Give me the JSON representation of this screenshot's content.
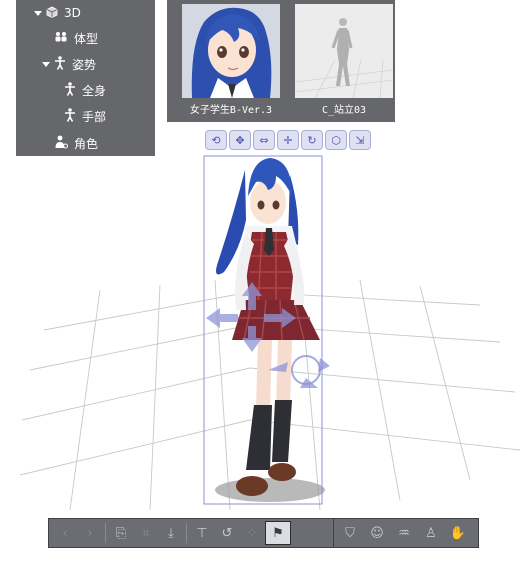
{
  "tree": {
    "items": [
      {
        "label": "3D",
        "icon": "cube-icon",
        "level": 0,
        "expanded": true
      },
      {
        "label": "体型",
        "icon": "body-shape-icon",
        "level": 1
      },
      {
        "label": "姿势",
        "icon": "pose-figure-icon",
        "level": 1,
        "expanded": true
      },
      {
        "label": "全身",
        "icon": "figure-icon",
        "level": 2
      },
      {
        "label": "手部",
        "icon": "figure-icon",
        "level": 2
      },
      {
        "label": "角色",
        "icon": "character-icon",
        "level": 1
      }
    ]
  },
  "preview": {
    "model_name": "女子学生B-Ver.3",
    "pose_name": "C_站立03"
  },
  "transform_toolbar": {
    "tools": [
      "rotate-camera-icon",
      "pan-camera-icon",
      "zoom-camera-icon",
      "move-object-icon",
      "rotate-object-icon",
      "rotate-3d-icon",
      "move-plane-icon"
    ]
  },
  "bottom_toolbar": {
    "left_tools": [
      {
        "icon": "prev-arrow-icon",
        "state": "disabled"
      },
      {
        "icon": "next-arrow-icon",
        "state": "disabled"
      },
      {
        "icon": "camera-view-icon",
        "state": "normal"
      },
      {
        "icon": "fit-view-icon",
        "state": "disabled"
      },
      {
        "icon": "ground-place-icon",
        "state": "normal"
      },
      {
        "icon": "pose-lock-icon",
        "state": "normal"
      },
      {
        "icon": "rotate-reset-icon",
        "state": "normal"
      },
      {
        "icon": "spin-icon",
        "state": "disabled"
      },
      {
        "icon": "flag-icon",
        "state": "active"
      }
    ],
    "right_tools": [
      "shield-icon",
      "face-icon",
      "hair-icon",
      "full-body-icon",
      "hand-icon"
    ]
  },
  "colors": {
    "panel_bg": "#66676b",
    "accent": "#4c55b8",
    "grid": "#c8c8c8",
    "selection_box": "#8c8fd8"
  }
}
